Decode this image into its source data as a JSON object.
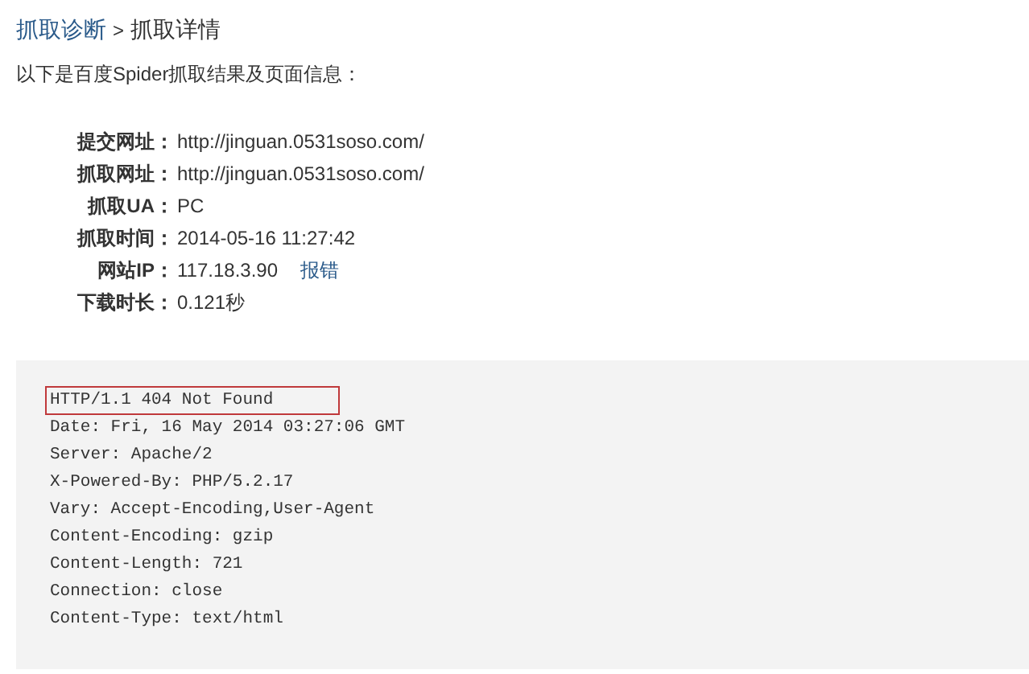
{
  "breadcrumb": {
    "link": "抓取诊断",
    "separator": ">",
    "current": "抓取详情"
  },
  "intro": "以下是百度Spider抓取结果及页面信息：",
  "info": [
    {
      "label": "提交网址：",
      "value": "http://jinguan.0531soso.com/"
    },
    {
      "label": "抓取网址：",
      "value": "http://jinguan.0531soso.com/"
    },
    {
      "label": "抓取UA：",
      "value": "PC"
    },
    {
      "label": "抓取时间：",
      "value": "2014-05-16 11:27:42"
    },
    {
      "label": "网站IP：",
      "value": "117.18.3.90",
      "link": "报错"
    },
    {
      "label": "下载时长：",
      "value": "0.121秒"
    }
  ],
  "response_headers": [
    {
      "text": "HTTP/1.1 404 Not Found",
      "highlighted": true
    },
    {
      "text": "Date: Fri, 16 May 2014 03:27:06 GMT",
      "highlighted": false
    },
    {
      "text": "Server: Apache/2",
      "highlighted": false
    },
    {
      "text": "X-Powered-By: PHP/5.2.17",
      "highlighted": false
    },
    {
      "text": "Vary: Accept-Encoding,User-Agent",
      "highlighted": false
    },
    {
      "text": "Content-Encoding: gzip",
      "highlighted": false
    },
    {
      "text": "Content-Length: 721",
      "highlighted": false
    },
    {
      "text": "Connection: close",
      "highlighted": false
    },
    {
      "text": "Content-Type: text/html",
      "highlighted": false
    }
  ]
}
